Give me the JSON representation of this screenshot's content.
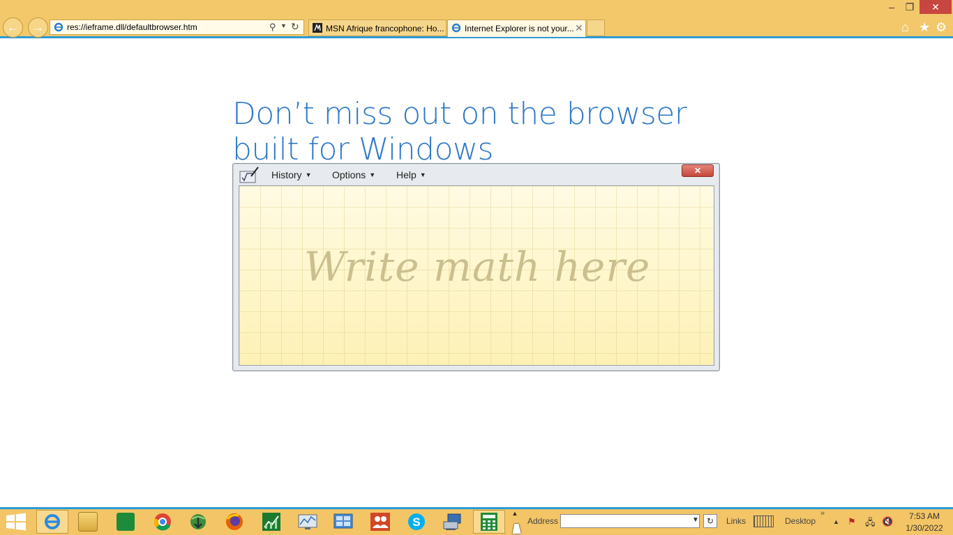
{
  "browser": {
    "address": "res://ieframe.dll/defaultbrowser.htm",
    "tabs": [
      {
        "label": "MSN Afrique francophone: Ho...",
        "active": false
      },
      {
        "label": "Internet Explorer is not your...",
        "active": true
      }
    ],
    "close_glyph": "✕",
    "colors": {
      "frame": "#f3c86a",
      "accent": "#2c9bd6",
      "close": "#c7463f"
    }
  },
  "page": {
    "headline_line1": "Don’t miss out on the browser",
    "headline_line2": "built for Windows",
    "headline_color": "#2f79c7"
  },
  "math_panel": {
    "menus": [
      "History",
      "Options",
      "Help"
    ],
    "close_glyph": "✕",
    "hint": "Write math here"
  },
  "taskbar": {
    "apps": [
      "internet-explorer",
      "file-explorer",
      "store",
      "chrome",
      "internet-download-manager",
      "firefox",
      "chart-app",
      "performance-monitor",
      "control-panel",
      "people",
      "skype",
      "network-app",
      "calculator"
    ],
    "address_label": "Address",
    "links_label": "Links",
    "desktop_label": "Desktop",
    "time": "7:53 AM",
    "date": "1/30/2022"
  }
}
